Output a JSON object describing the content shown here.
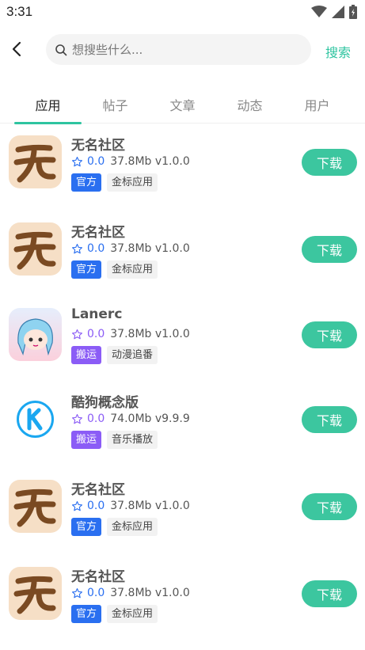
{
  "status": {
    "time": "3:31"
  },
  "search": {
    "placeholder": "想搜些什么...",
    "submit_label": "搜索"
  },
  "tabs": [
    {
      "label": "应用",
      "active": true
    },
    {
      "label": "帖子",
      "active": false
    },
    {
      "label": "文章",
      "active": false
    },
    {
      "label": "动态",
      "active": false
    },
    {
      "label": "用户",
      "active": false
    }
  ],
  "colors": {
    "accent": "#2ec4a0",
    "official": "#2a6ff0",
    "repost": "#8b5cf6"
  },
  "apps": [
    {
      "name": "无名社区",
      "rating": "0.0",
      "size": "37.8Mb",
      "version": "v1.0.0",
      "tag_primary": "官方",
      "tag_secondary": "金标应用",
      "tag_color": "#2a6ff0",
      "icon": "wuming-logo",
      "download_label": "下载"
    },
    {
      "name": "无名社区",
      "rating": "0.0",
      "size": "37.8Mb",
      "version": "v1.0.0",
      "tag_primary": "官方",
      "tag_secondary": "金标应用",
      "tag_color": "#2a6ff0",
      "icon": "wuming-logo",
      "download_label": "下载"
    },
    {
      "name": "Lanerc",
      "rating": "0.0",
      "size": "37.8Mb",
      "version": "v1.0.0",
      "tag_primary": "搬运",
      "tag_secondary": "动漫追番",
      "tag_color": "#8b5cf6",
      "icon": "anime-avatar",
      "download_label": "下载"
    },
    {
      "name": "酷狗概念版",
      "rating": "0.0",
      "size": "74.0Mb",
      "version": "v9.9.9",
      "tag_primary": "搬运",
      "tag_secondary": "音乐播放",
      "tag_color": "#8b5cf6",
      "icon": "kugou-logo",
      "download_label": "下载"
    },
    {
      "name": "无名社区",
      "rating": "0.0",
      "size": "37.8Mb",
      "version": "v1.0.0",
      "tag_primary": "官方",
      "tag_secondary": "金标应用",
      "tag_color": "#2a6ff0",
      "icon": "wuming-logo",
      "download_label": "下载"
    },
    {
      "name": "无名社区",
      "rating": "0.0",
      "size": "37.8Mb",
      "version": "v1.0.0",
      "tag_primary": "官方",
      "tag_secondary": "金标应用",
      "tag_color": "#2a6ff0",
      "icon": "wuming-logo",
      "download_label": "下载"
    }
  ]
}
